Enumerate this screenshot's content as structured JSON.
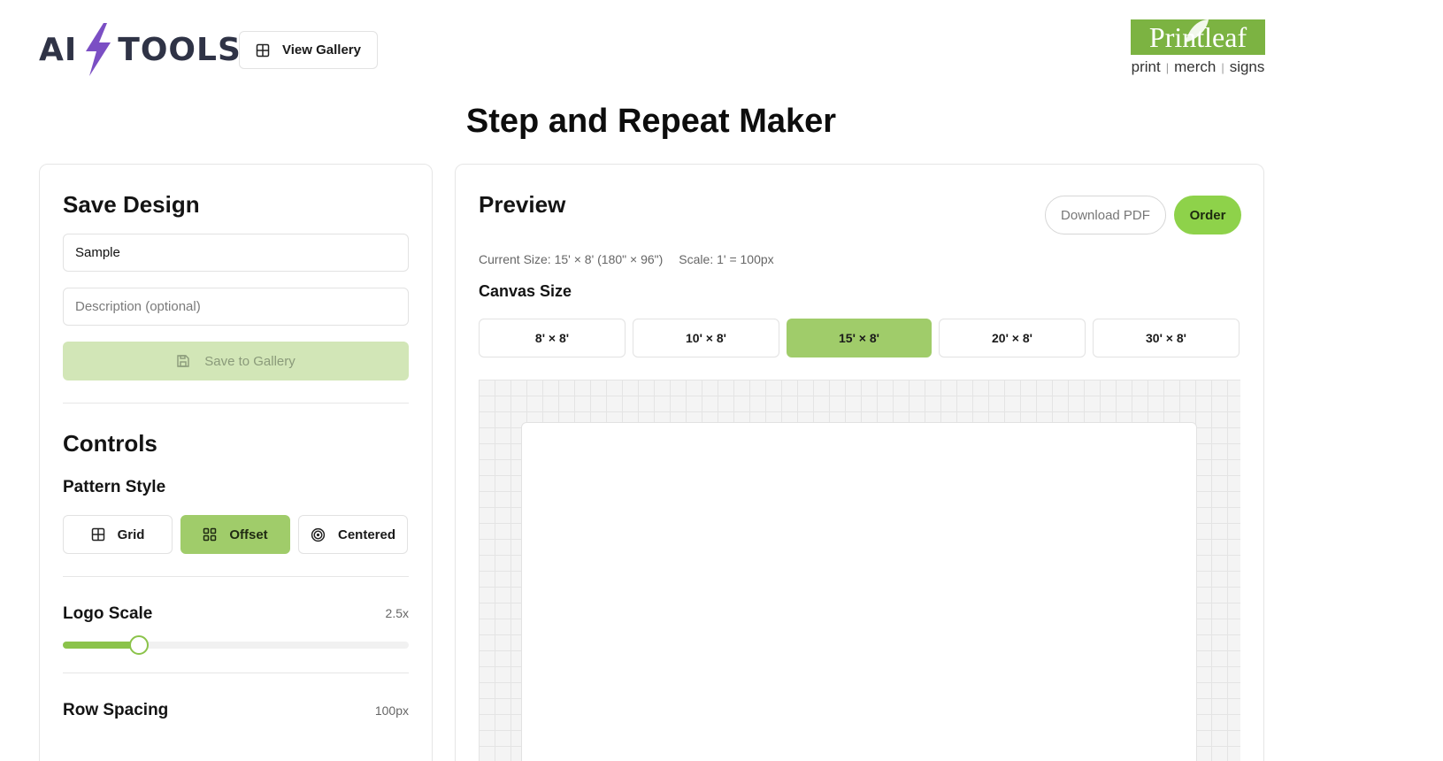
{
  "header": {
    "brand_left": "AI",
    "brand_right": "TOOLS",
    "view_gallery_label": "View Gallery",
    "partner_logo": {
      "name": "Printleaf",
      "tag_print": "print",
      "tag_merch": "merch",
      "tag_signs": "signs",
      "color": "#7cb342"
    }
  },
  "page_title": "Step and Repeat Maker",
  "save_design": {
    "heading": "Save Design",
    "name_value": "Sample",
    "description_placeholder": "Description (optional)",
    "save_label": "Save to Gallery"
  },
  "controls": {
    "heading": "Controls",
    "pattern_style_label": "Pattern Style",
    "patterns": [
      {
        "label": "Grid",
        "active": false
      },
      {
        "label": "Offset",
        "active": true
      },
      {
        "label": "Centered",
        "active": false
      }
    ],
    "logo_scale": {
      "label": "Logo Scale",
      "value": "2.5x",
      "fraction": 0.22
    },
    "row_spacing": {
      "label": "Row Spacing",
      "value": "100px"
    }
  },
  "preview": {
    "heading": "Preview",
    "download_label": "Download PDF",
    "order_label": "Order",
    "current_size": "Current Size: 15' × 8' (180\" × 96\")",
    "scale": "Scale: 1' = 100px",
    "canvas_size_label": "Canvas Size",
    "sizes": [
      {
        "label": "8' × 8'",
        "active": false
      },
      {
        "label": "10' × 8'",
        "active": false
      },
      {
        "label": "15' × 8'",
        "active": true
      },
      {
        "label": "20' × 8'",
        "active": false
      },
      {
        "label": "30' × 8'",
        "active": false
      }
    ]
  },
  "colors": {
    "accent": "#a0cc6a",
    "order_button": "#8ed24a",
    "bolt": "#7b4fc4"
  }
}
